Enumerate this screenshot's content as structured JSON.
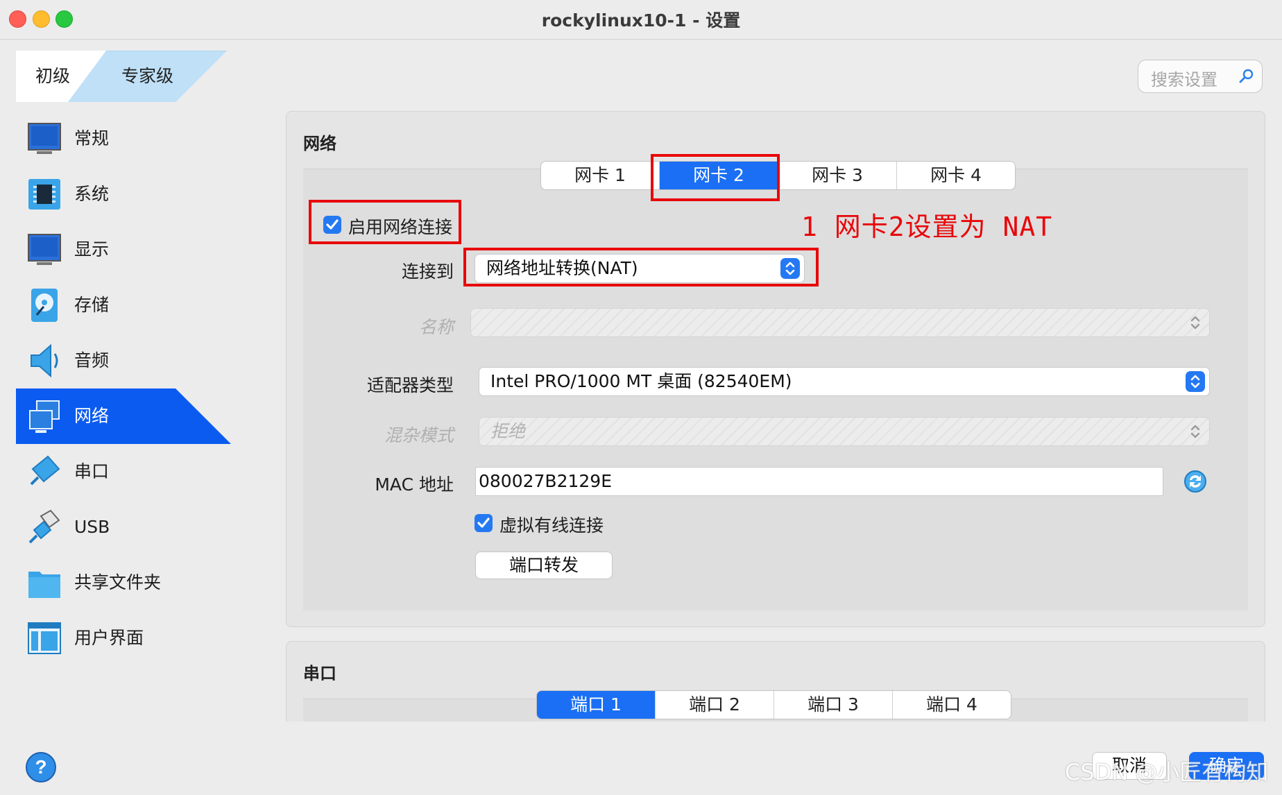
{
  "window": {
    "title": "rockylinux10-1 - 设置"
  },
  "mode_tabs": {
    "basic": "初级",
    "expert": "专家级"
  },
  "search": {
    "placeholder": "搜索设置"
  },
  "sidebar": {
    "items": [
      {
        "label": "常规",
        "icon": "general-monitor-icon"
      },
      {
        "label": "系统",
        "icon": "system-chip-icon"
      },
      {
        "label": "显示",
        "icon": "display-monitor-icon"
      },
      {
        "label": "存储",
        "icon": "storage-disk-icon"
      },
      {
        "label": "音频",
        "icon": "audio-speaker-icon"
      },
      {
        "label": "网络",
        "icon": "network-icon",
        "selected": true
      },
      {
        "label": "串口",
        "icon": "serial-port-icon"
      },
      {
        "label": "USB",
        "icon": "usb-icon"
      },
      {
        "label": "共享文件夹",
        "icon": "folder-icon"
      },
      {
        "label": "用户界面",
        "icon": "user-interface-icon"
      }
    ]
  },
  "network": {
    "title": "网络",
    "tabs": [
      "网卡 1",
      "网卡 2",
      "网卡 3",
      "网卡 4"
    ],
    "active_tab": "网卡 2",
    "enable_label": "启用网络连接",
    "enable_checked": true,
    "attached_label": "连接到",
    "attached_value": "网络地址转换(NAT)",
    "name_label": "名称",
    "name_value": "",
    "adapter_label": "适配器类型",
    "adapter_value": "Intel PRO/1000 MT 桌面 (82540EM)",
    "promisc_label": "混杂模式",
    "promisc_value": "拒绝",
    "mac_label": "MAC 地址",
    "mac_value": "080027B2129E",
    "cable_label": "虚拟有线连接",
    "cable_checked": true,
    "port_forward_label": "端口转发"
  },
  "annotation": "1 网卡2设置为 NAT",
  "serial": {
    "title": "串口",
    "tabs": [
      "端口 1",
      "端口 2",
      "端口 3",
      "端口 4"
    ],
    "active_tab": "端口 1"
  },
  "footer": {
    "cancel": "取消",
    "ok": "确定",
    "help_icon": "help-icon"
  },
  "watermark": "CSDN @小匠有构知",
  "colors": {
    "accent": "#1a6ff4",
    "selection": "#0b5bf0",
    "annotation": "#e8070a"
  }
}
